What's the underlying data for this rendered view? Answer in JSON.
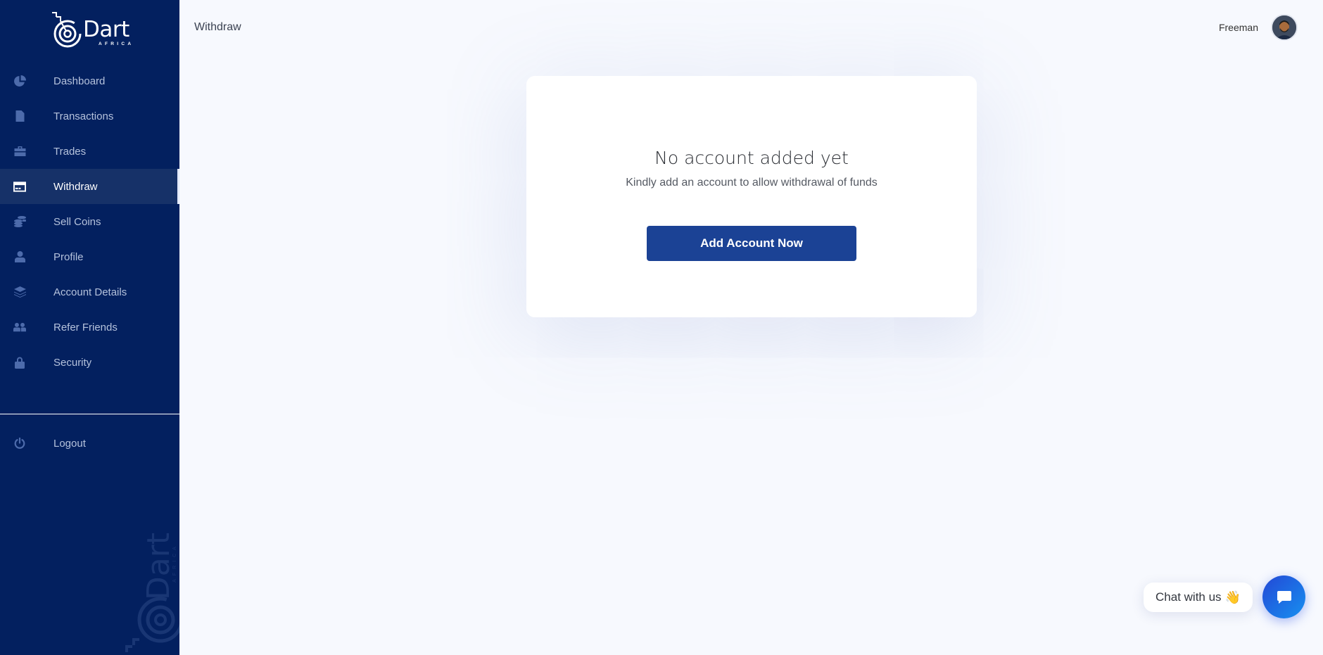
{
  "brand": {
    "name": "Dart",
    "tagline": "AFRICA"
  },
  "sidebar": {
    "items": [
      {
        "label": "Dashboard",
        "icon": "pie-chart-icon",
        "active": false
      },
      {
        "label": "Transactions",
        "icon": "file-icon",
        "active": false
      },
      {
        "label": "Trades",
        "icon": "briefcase-icon",
        "active": false
      },
      {
        "label": "Withdraw",
        "icon": "credit-card-icon",
        "active": true
      },
      {
        "label": "Sell Coins",
        "icon": "coins-icon",
        "active": false
      },
      {
        "label": "Profile",
        "icon": "user-tie-icon",
        "active": false
      },
      {
        "label": "Account Details",
        "icon": "layers-icon",
        "active": false
      },
      {
        "label": "Refer Friends",
        "icon": "users-icon",
        "active": false
      },
      {
        "label": "Security",
        "icon": "lock-icon",
        "active": false
      }
    ],
    "logout": {
      "label": "Logout",
      "icon": "power-icon"
    }
  },
  "header": {
    "title": "Withdraw",
    "user_name": "Freeman"
  },
  "main": {
    "empty_title": "No account added yet",
    "empty_subtitle": "Kindly add an account to allow withdrawal of funds",
    "add_button": "Add Account Now"
  },
  "chat": {
    "label": "Chat with us",
    "emoji": "👋"
  },
  "colors": {
    "sidebar_bg": "#03205f",
    "active_item_bg": "#163168",
    "primary_button": "#1b4295",
    "page_bg": "#f7f9fe"
  }
}
